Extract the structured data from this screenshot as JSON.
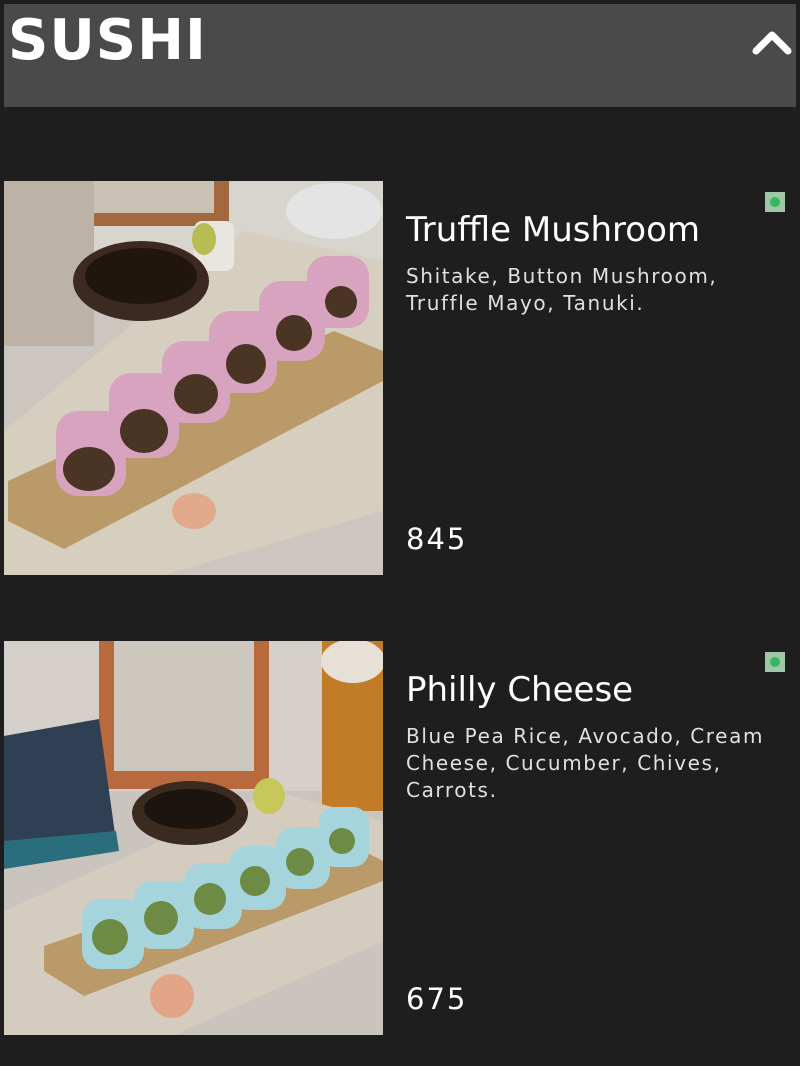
{
  "section": {
    "title": "SUSHI",
    "collapse_icon": "chevron-up-icon"
  },
  "items": [
    {
      "name": "Truffle Mushroom",
      "description": "Shitake, Button Mushroom, Truffle Mayo, Tanuki.",
      "price": "845",
      "veg_indicator": "veg-icon",
      "image_icon": "sushi-photo"
    },
    {
      "name": "Philly Cheese",
      "description": "Blue Pea Rice, Avocado, Cream Cheese, Cucumber, Chives, Carrots.",
      "price": "675",
      "veg_indicator": "veg-icon",
      "image_icon": "sushi-photo"
    }
  ],
  "colors": {
    "background": "#1e1e1e",
    "header": "#4a4a4a",
    "veg_badge": "#9fc7a5",
    "veg_dot": "#35b862"
  }
}
